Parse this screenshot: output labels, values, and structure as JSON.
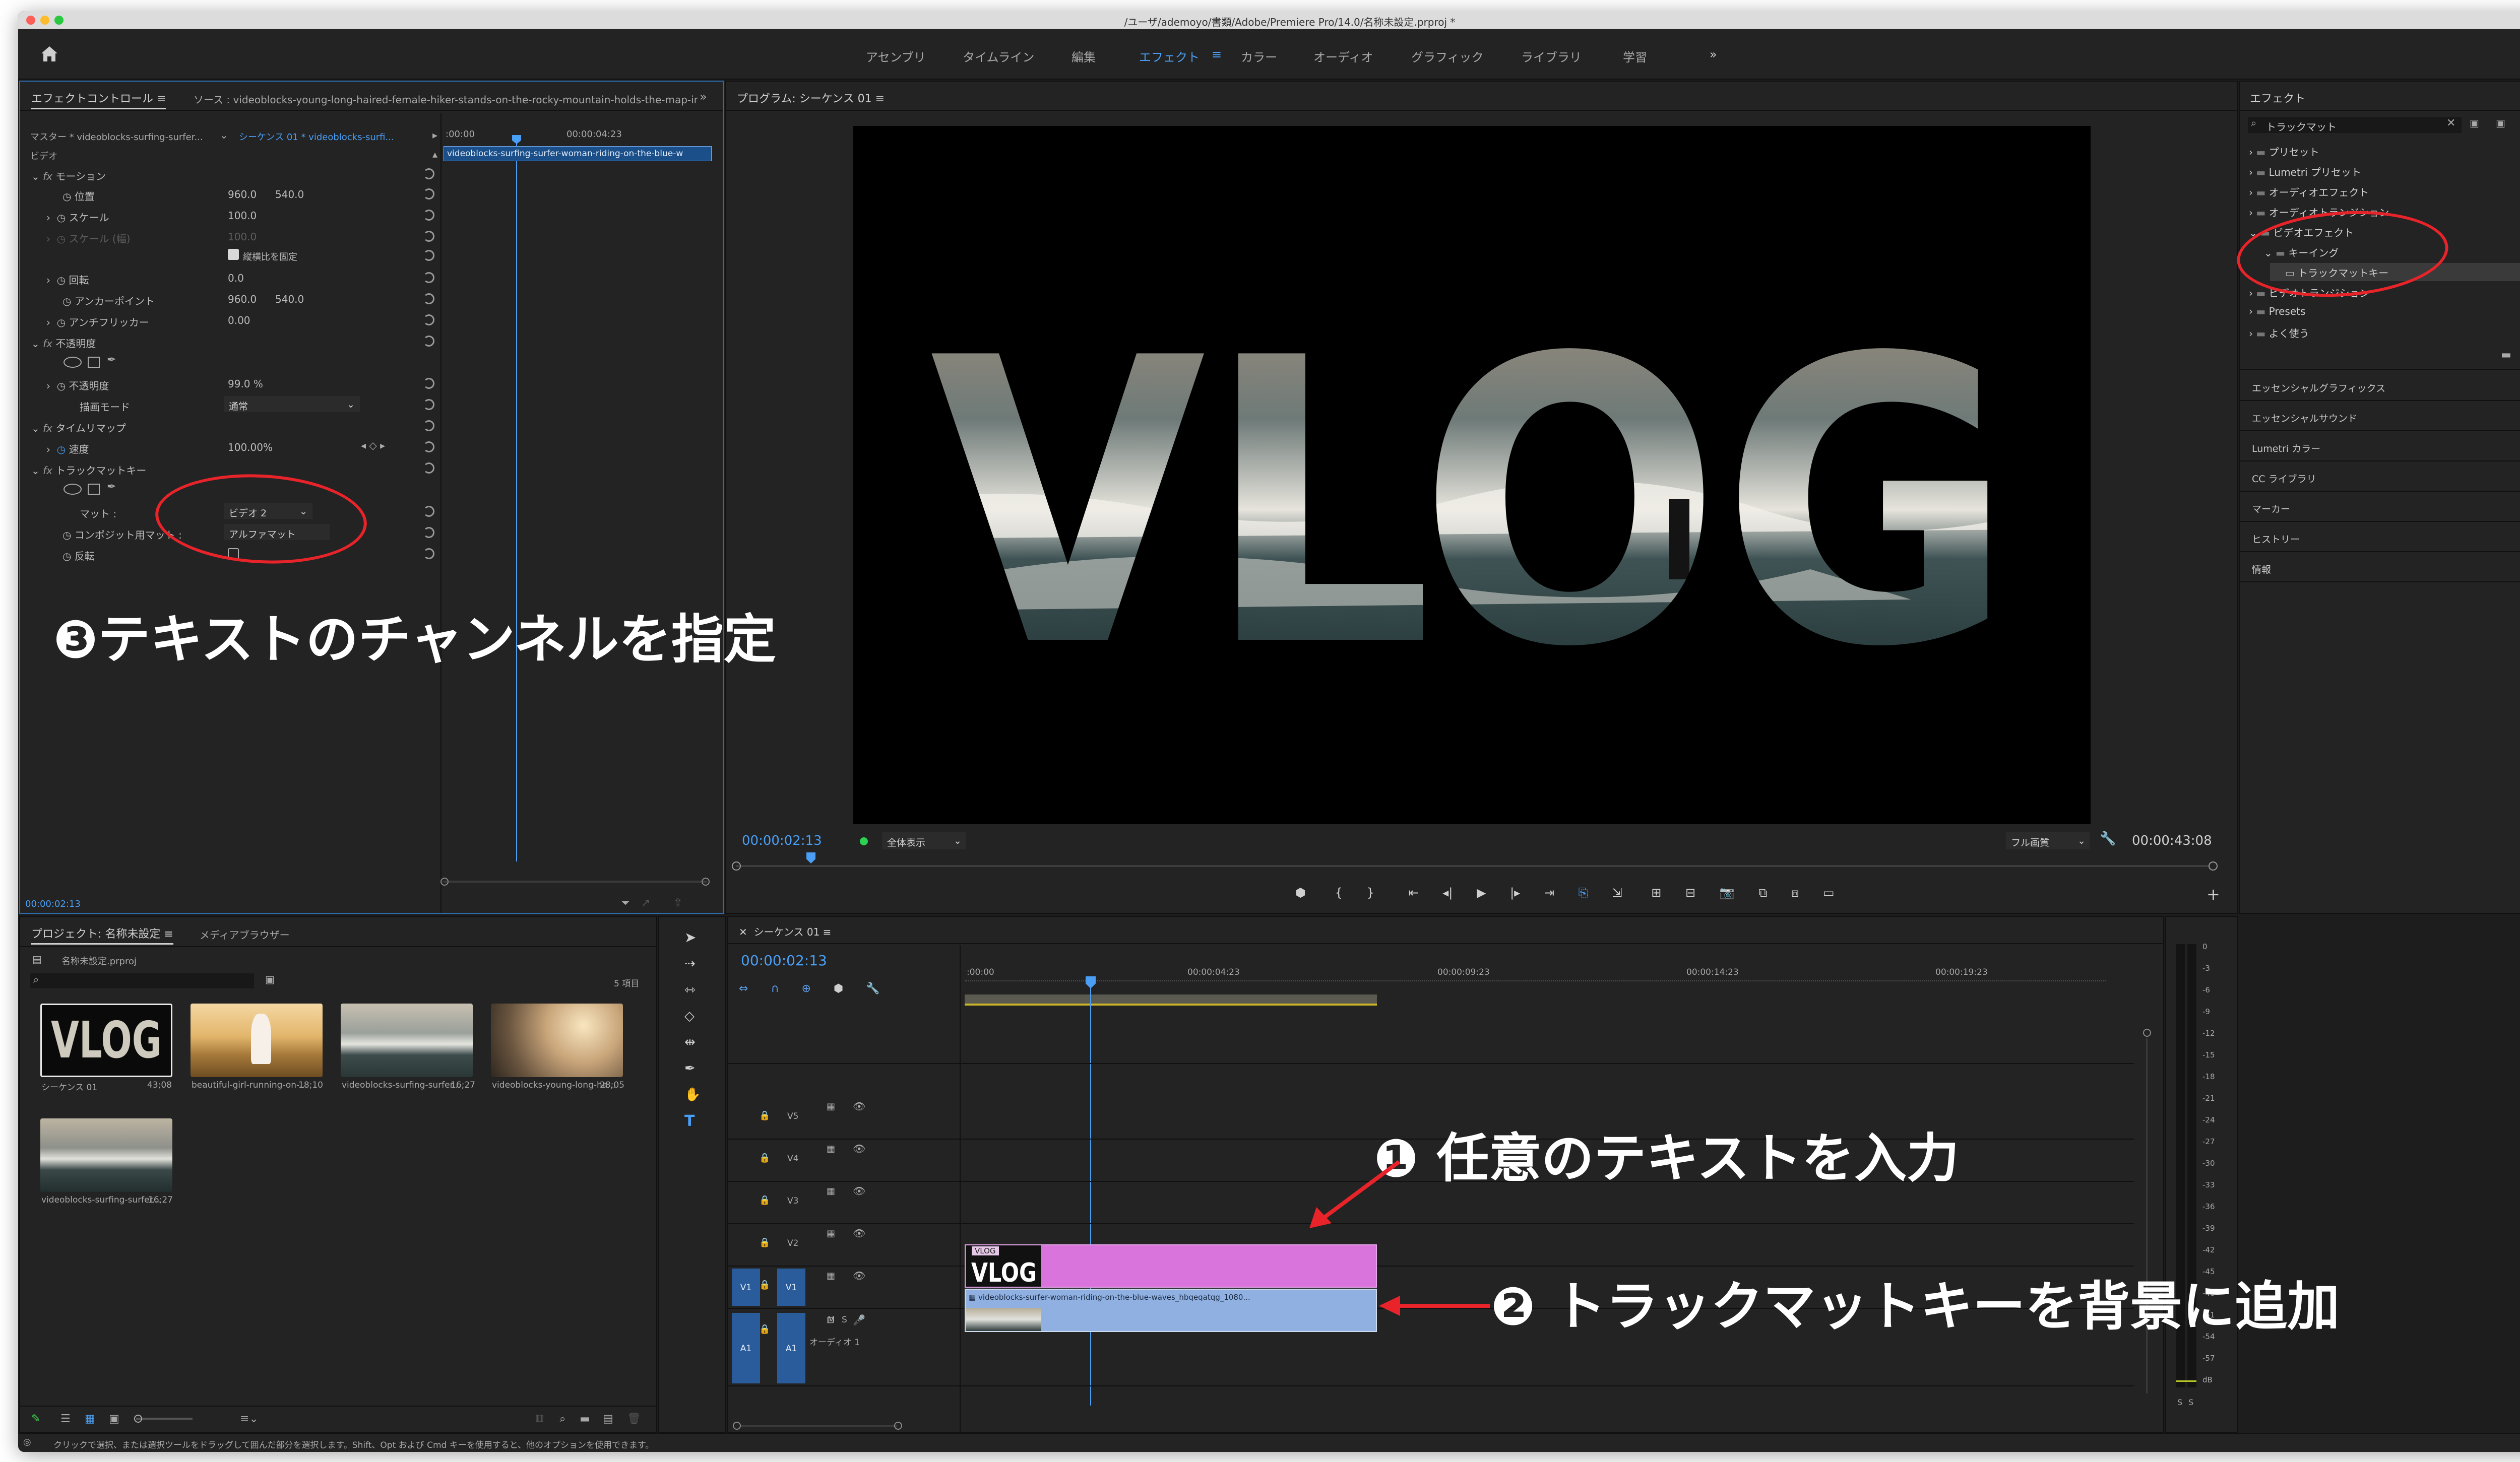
{
  "window": {
    "title": "/ユーザ/ademoyo/書類/Adobe/Premiere Pro/14.0/名称未設定.prproj *"
  },
  "workspaces": [
    "アセンブリ",
    "タイムライン",
    "編集",
    "エフェクト",
    "カラー",
    "オーディオ",
    "グラフィック",
    "ライブラリ",
    "学習"
  ],
  "workspace_menu": "≡",
  "workspace_more": "»",
  "effect_controls": {
    "tab": "エフェクトコントロール",
    "tab_menu": "≡",
    "source": "ソース : videoblocks-young-long-haired-female-hiker-stands-on-the-rocky-mountain-holds-the-map-in-a",
    "master": "マスター * videoblocks-surfing-surfer...",
    "sequence": "シーケンス 01 * videoblocks-surfi...",
    "video_label": "ビデオ",
    "rows": [
      {
        "fx": "fx",
        "name": "モーション"
      },
      {
        "name": "位置",
        "v1": "960.0",
        "v2": "540.0"
      },
      {
        "name": "スケール",
        "v1": "100.0"
      },
      {
        "name": "スケール (幅)",
        "v1": "100.0"
      },
      {
        "name": "縦横比を固定"
      },
      {
        "name": "回転",
        "v1": "0.0"
      },
      {
        "name": "アンカーポイント",
        "v1": "960.0",
        "v2": "540.0"
      },
      {
        "name": "アンチフリッカー",
        "v1": "0.00"
      },
      {
        "fx": "fx",
        "name": "不透明度"
      },
      {
        "name": "不透明度",
        "v1": "99.0 %"
      },
      {
        "name": "描画モード",
        "v1": "通常"
      },
      {
        "fx": "fx",
        "name": "タイムリマップ"
      },
      {
        "name": "速度",
        "v1": "100.00%"
      },
      {
        "fx": "fx",
        "name": "トラックマットキー"
      },
      {
        "name": "マット :",
        "v1": "ビデオ 2"
      },
      {
        "name": "コンポジット用マット :",
        "v1": "アルファマット"
      },
      {
        "name": "反転"
      }
    ],
    "ruler_start": ":00:00",
    "ruler_mid": "00:00:04:23",
    "clip": "videoblocks-surfing-surfer-woman-riding-on-the-blue-w",
    "timecode": "00:00:02:13"
  },
  "program": {
    "title": "プログラム: シーケンス 01",
    "title_menu": "≡",
    "overlay_text": "VLOG",
    "timecode": "00:00:02:13",
    "fit": "全体表示",
    "quality": "フル画質",
    "duration": "00:00:43:08",
    "controls": [
      "marker",
      "in",
      "out",
      "go-in",
      "step-back",
      "play",
      "step-fwd",
      "go-out",
      "insert",
      "overwrite",
      "lift",
      "extract",
      "export-frame",
      "compare",
      "multi",
      "settings"
    ]
  },
  "effects_panel": {
    "title": "エフェクト",
    "menu": "≡",
    "search": "トラックマット",
    "tree": [
      {
        "label": "プリセット"
      },
      {
        "label": "Lumetri プリセット"
      },
      {
        "label": "オーディオエフェクト"
      },
      {
        "label": "オーディオトランジション"
      },
      {
        "label": "ビデオエフェクト"
      },
      {
        "label": "キーイング"
      },
      {
        "label": "トラックマットキー"
      },
      {
        "label": "ビデオトランジション"
      },
      {
        "label": "Presets"
      },
      {
        "label": "よく使う"
      }
    ],
    "panels": [
      "エッセンシャルグラフィックス",
      "エッセンシャルサウンド",
      "Lumetri カラー",
      "CC ライブラリ",
      "マーカー",
      "ヒストリー",
      "情報"
    ]
  },
  "project": {
    "tab": "プロジェクト: 名称未設定",
    "tab_menu": "≡",
    "tab2": "メディアブラウザー",
    "file": "名称未設定.prproj",
    "count": "5 項目",
    "items": [
      {
        "name": "シーケンス 01",
        "dur": "43;08"
      },
      {
        "name": "beautiful-girl-running-on-...",
        "dur": "18;10"
      },
      {
        "name": "videoblocks-surfing-surfer...",
        "dur": "16;27"
      },
      {
        "name": "videoblocks-young-long-ha...",
        "dur": "28;05"
      },
      {
        "name": "videoblocks-surfing-surfer...",
        "dur": "16;27"
      }
    ]
  },
  "timeline": {
    "title": "シーケンス 01",
    "title_menu": "≡",
    "timecode": "00:00:02:13",
    "ruler": [
      ":00:00",
      "00:00:04:23",
      "00:00:09:23",
      "00:00:14:23",
      "00:00:19:23"
    ],
    "tracks": [
      "V5",
      "V4",
      "V3",
      "V2",
      "V1",
      "A1"
    ],
    "v1_patch": "V1",
    "a1_patch": "A1",
    "audio_name": "オーディオ 1",
    "mute_label": "M",
    "solo_label": "S",
    "clip_v2": "VLOG",
    "clip_v1": "videoblocks-surfer-woman-riding-on-the-blue-waves_hbqeqatqg_1080..."
  },
  "meter": {
    "ticks": [
      "0",
      "-3",
      "-6",
      "-9",
      "-12",
      "-15",
      "-18",
      "-21",
      "-24",
      "-27",
      "-30",
      "-33",
      "-36",
      "-39",
      "-42",
      "-45",
      "-48",
      "-51",
      "-54",
      "-57",
      "dB"
    ],
    "footer": [
      "S",
      "S"
    ]
  },
  "status": "クリックで選択、または選択ツールをドラッグして囲んだ部分を選択します。Shift、Opt および Cmd キーを使用すると、他のオプションを使用できます。",
  "annotations": {
    "step1": "❶ 任意のテキストを入力",
    "step2": "❷ トラックマットキーを背景に追加",
    "step3": "❸テキストのチャンネルを指定"
  },
  "colors": {
    "accent": "#4a9ff5",
    "annotation": "#e8242a",
    "clip_v2": "#d874dc",
    "clip_v1": "#8fb0e0"
  }
}
